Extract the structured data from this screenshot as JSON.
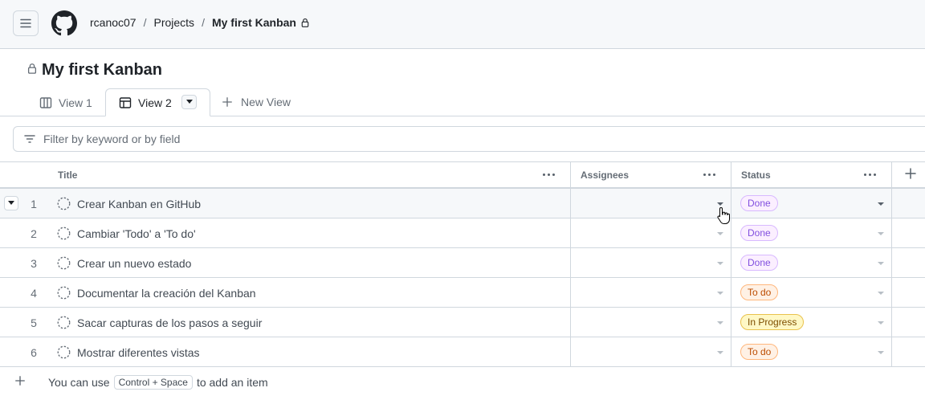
{
  "header": {
    "menu_icon": "hamburger-icon",
    "logo_icon": "github-logo-icon",
    "breadcrumbs": [
      "rcanoc07",
      "Projects",
      "My first Kanban"
    ],
    "separator": "/"
  },
  "project": {
    "title": "My first Kanban"
  },
  "tabs": [
    {
      "label": "View 1",
      "icon": "board-icon"
    },
    {
      "label": "View 2",
      "icon": "table-icon",
      "active": true
    }
  ],
  "new_view_label": "New View",
  "filter": {
    "placeholder": "Filter by keyword or by field"
  },
  "columns": {
    "title": "Title",
    "assignees": "Assignees",
    "status": "Status"
  },
  "rows": [
    {
      "num": "1",
      "title": "Crear Kanban en GitHub",
      "status": "Done",
      "kind": "done"
    },
    {
      "num": "2",
      "title": "Cambiar 'Todo' a 'To do'",
      "status": "Done",
      "kind": "done"
    },
    {
      "num": "3",
      "title": "Crear un nuevo estado",
      "status": "Done",
      "kind": "done"
    },
    {
      "num": "4",
      "title": "Documentar la creación del Kanban",
      "status": "To do",
      "kind": "todo"
    },
    {
      "num": "5",
      "title": "Sacar capturas de los pasos a seguir",
      "status": "In Progress",
      "kind": "prog"
    },
    {
      "num": "6",
      "title": "Mostrar diferentes vistas",
      "status": "To do",
      "kind": "todo"
    }
  ],
  "footer": {
    "prefix": "You can use",
    "shortcut": "Control + Space",
    "suffix": "to add an item"
  },
  "colors": {
    "done": "#8250df",
    "todo": "#bc4c00",
    "in_progress": "#7d4e00",
    "border": "#d0d7de"
  }
}
